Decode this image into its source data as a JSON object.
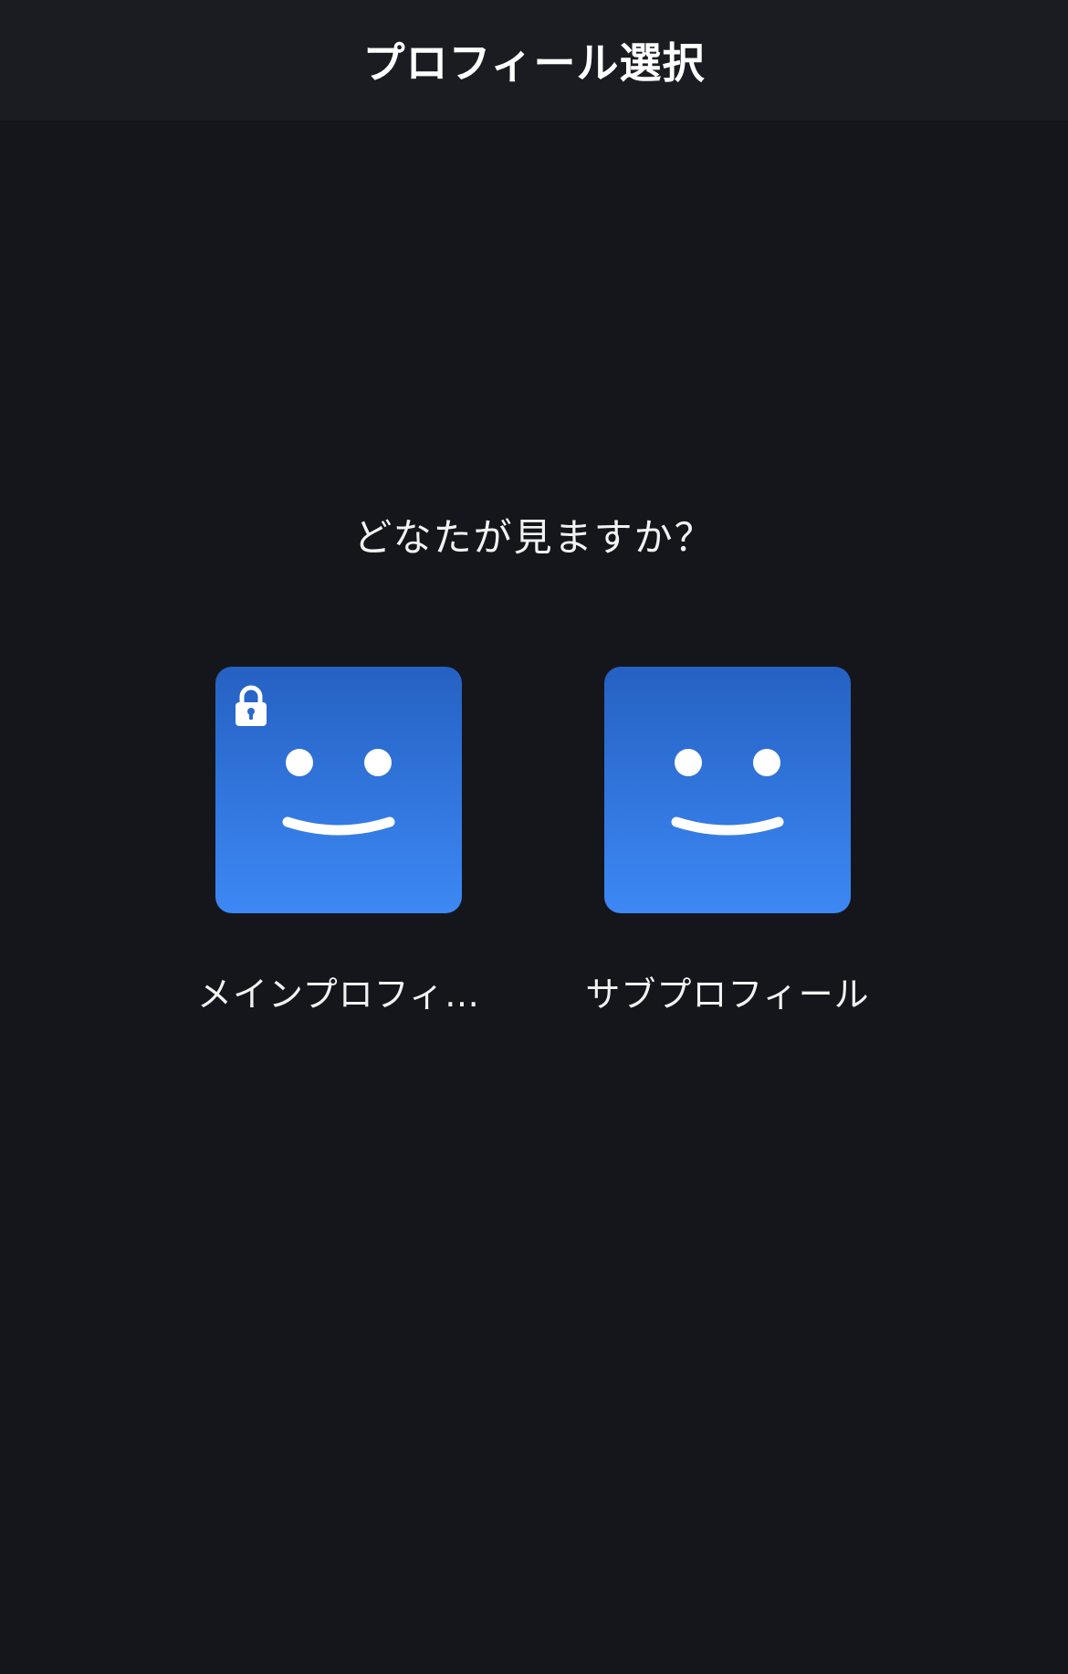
{
  "header": {
    "title": "プロフィール選択"
  },
  "main": {
    "prompt": "どなたが見ますか？",
    "profiles": [
      {
        "name": "メインプロフィ…",
        "locked": true,
        "avatar_icon": "smiley-face-icon",
        "color": "#3580e8"
      },
      {
        "name": "サブプロフィール",
        "locked": false,
        "avatar_icon": "smiley-face-icon",
        "color": "#3580e8"
      }
    ]
  },
  "colors": {
    "background": "#15161b",
    "header_background": "#1b1c21",
    "avatar_top": "#2561c2",
    "avatar_bottom": "#3d88f5",
    "text": "#ffffff"
  }
}
